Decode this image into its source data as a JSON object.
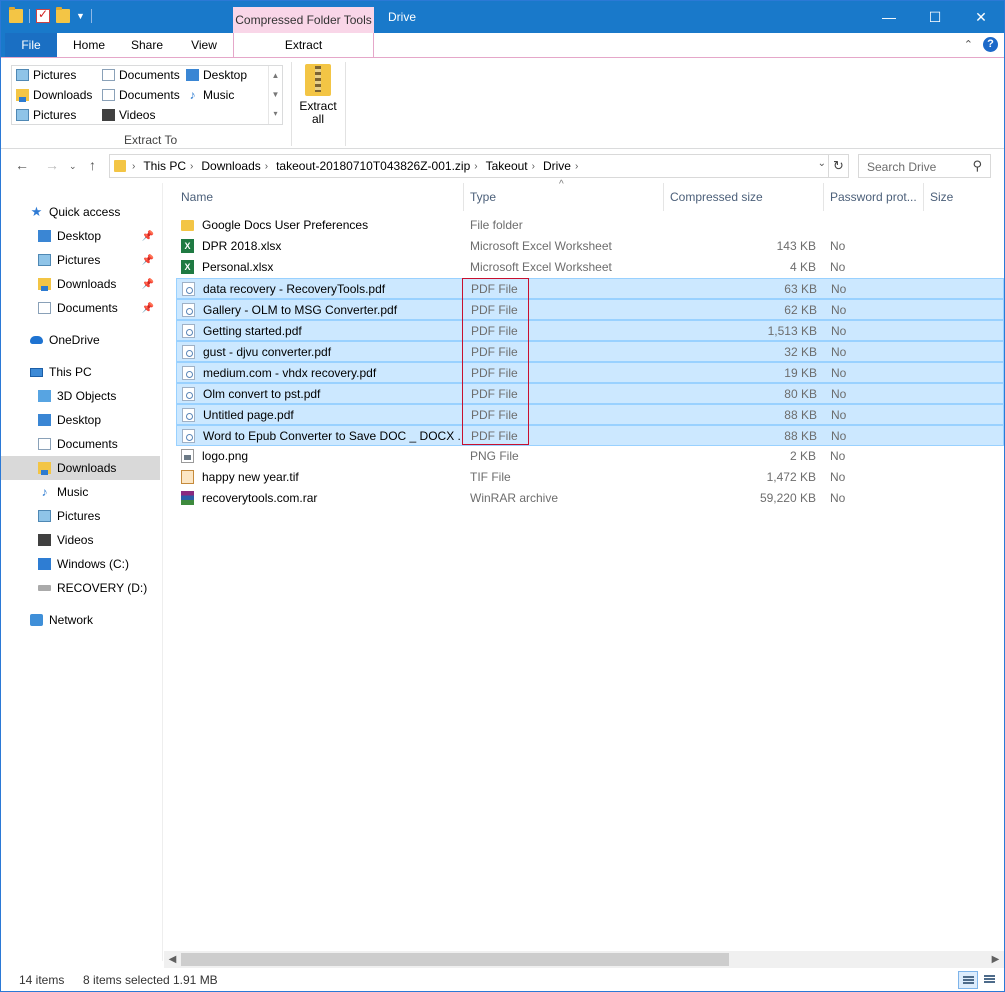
{
  "window": {
    "context_tab": "Compressed Folder Tools",
    "title": "Drive",
    "controls": {
      "minimize": "—",
      "maximize": "☐",
      "close": "✕"
    }
  },
  "ribbon": {
    "tabs": [
      "File",
      "Home",
      "Share",
      "View",
      "Extract"
    ],
    "active_tab": "Extract",
    "extract_to": {
      "items": [
        "Pictures",
        "Documents",
        "Desktop",
        "Downloads",
        "Documents",
        "Music",
        "Pictures",
        "Videos"
      ],
      "group_label": "Extract To"
    },
    "extract_all_label": "Extract\nall"
  },
  "address": {
    "crumbs": [
      "This PC",
      "Downloads",
      "takeout-20180710T043826Z-001.zip",
      "Takeout",
      "Drive"
    ],
    "search_placeholder": "Search Drive"
  },
  "navpane": {
    "items": [
      {
        "label": "Quick access",
        "icon": "star-icon",
        "level": 0
      },
      {
        "label": "Desktop",
        "icon": "desktop-icon",
        "level": 1,
        "pinned": true
      },
      {
        "label": "Pictures",
        "icon": "pictures-icon",
        "level": 1,
        "pinned": true
      },
      {
        "label": "Downloads",
        "icon": "downloads-icon",
        "level": 1,
        "pinned": true
      },
      {
        "label": "Documents",
        "icon": "documents-icon",
        "level": 1,
        "pinned": true
      },
      {
        "label": "OneDrive",
        "icon": "cloud-icon",
        "level": 0
      },
      {
        "label": "This PC",
        "icon": "pc-icon",
        "level": 0
      },
      {
        "label": "3D Objects",
        "icon": "objects-icon",
        "level": 1
      },
      {
        "label": "Desktop",
        "icon": "desktop-icon",
        "level": 1
      },
      {
        "label": "Documents",
        "icon": "documents-icon",
        "level": 1
      },
      {
        "label": "Downloads",
        "icon": "downloads-icon",
        "level": 1,
        "selected": true
      },
      {
        "label": "Music",
        "icon": "music-icon",
        "level": 1
      },
      {
        "label": "Pictures",
        "icon": "pictures-icon",
        "level": 1
      },
      {
        "label": "Videos",
        "icon": "videos-icon",
        "level": 1
      },
      {
        "label": "Windows (C:)",
        "icon": "windows-drive-icon",
        "level": 1
      },
      {
        "label": "RECOVERY (D:)",
        "icon": "drive-icon",
        "level": 1
      },
      {
        "label": "Network",
        "icon": "network-icon",
        "level": 0
      }
    ]
  },
  "columns": [
    "Name",
    "Type",
    "Compressed size",
    "Password prot...",
    "Size"
  ],
  "files": [
    {
      "name": "Google Docs User Preferences",
      "type": "File folder",
      "csize": "",
      "pw": "",
      "icon": "folder",
      "selected": false
    },
    {
      "name": "DPR 2018.xlsx",
      "type": "Microsoft Excel Worksheet",
      "csize": "143 KB",
      "pw": "No",
      "icon": "xls",
      "selected": false
    },
    {
      "name": "Personal.xlsx",
      "type": "Microsoft Excel Worksheet",
      "csize": "4 KB",
      "pw": "No",
      "icon": "xls",
      "selected": false
    },
    {
      "name": "data recovery - RecoveryTools.pdf",
      "type": "PDF File",
      "csize": "63 KB",
      "pw": "No",
      "icon": "pdf",
      "selected": true
    },
    {
      "name": "Gallery - OLM to MSG Converter.pdf",
      "type": "PDF File",
      "csize": "62 KB",
      "pw": "No",
      "icon": "pdf",
      "selected": true
    },
    {
      "name": "Getting started.pdf",
      "type": "PDF File",
      "csize": "1,513 KB",
      "pw": "No",
      "icon": "pdf",
      "selected": true
    },
    {
      "name": "gust - djvu converter.pdf",
      "type": "PDF File",
      "csize": "32 KB",
      "pw": "No",
      "icon": "pdf",
      "selected": true
    },
    {
      "name": "medium.com - vhdx recovery.pdf",
      "type": "PDF File",
      "csize": "19 KB",
      "pw": "No",
      "icon": "pdf",
      "selected": true
    },
    {
      "name": "Olm convert to pst.pdf",
      "type": "PDF File",
      "csize": "80 KB",
      "pw": "No",
      "icon": "pdf",
      "selected": true
    },
    {
      "name": "Untitled page.pdf",
      "type": "PDF File",
      "csize": "88 KB",
      "pw": "No",
      "icon": "pdf",
      "selected": true
    },
    {
      "name": "Word to Epub Converter to Save DOC _ DOCX ...",
      "type": "PDF File",
      "csize": "88 KB",
      "pw": "No",
      "icon": "pdf",
      "selected": true
    },
    {
      "name": "logo.png",
      "type": "PNG File",
      "csize": "2 KB",
      "pw": "No",
      "icon": "png",
      "selected": false
    },
    {
      "name": "happy new year.tif",
      "type": "TIF File",
      "csize": "1,472 KB",
      "pw": "No",
      "icon": "tif",
      "selected": false
    },
    {
      "name": "recoverytools.com.rar",
      "type": "WinRAR archive",
      "csize": "59,220 KB",
      "pw": "No",
      "icon": "rar",
      "selected": false
    }
  ],
  "status": {
    "count": "14 items",
    "selected": "8 items selected",
    "size": "1.91 MB"
  }
}
